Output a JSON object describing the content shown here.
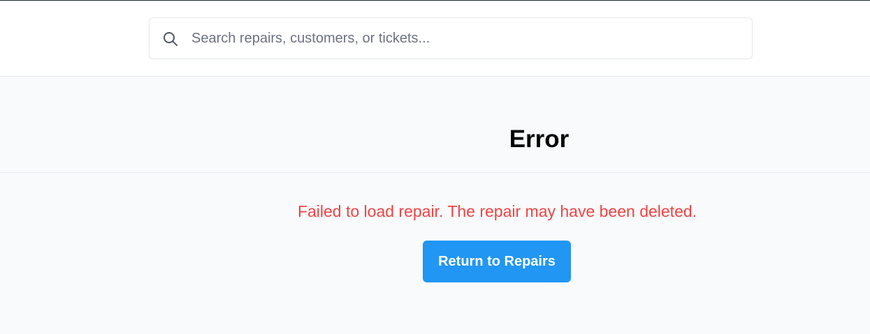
{
  "search": {
    "placeholder": "Search repairs, customers, or tickets...",
    "value": "",
    "icon": "search-icon"
  },
  "page": {
    "title": "Error"
  },
  "error": {
    "message": "Failed to load repair. The repair may have been deleted."
  },
  "actions": {
    "return_label": "Return to Repairs"
  },
  "colors": {
    "accent": "#2196f3",
    "error": "#ef4444",
    "background": "#f9fafb",
    "header_background": "#ffffff",
    "border": "#e5e7eb"
  }
}
